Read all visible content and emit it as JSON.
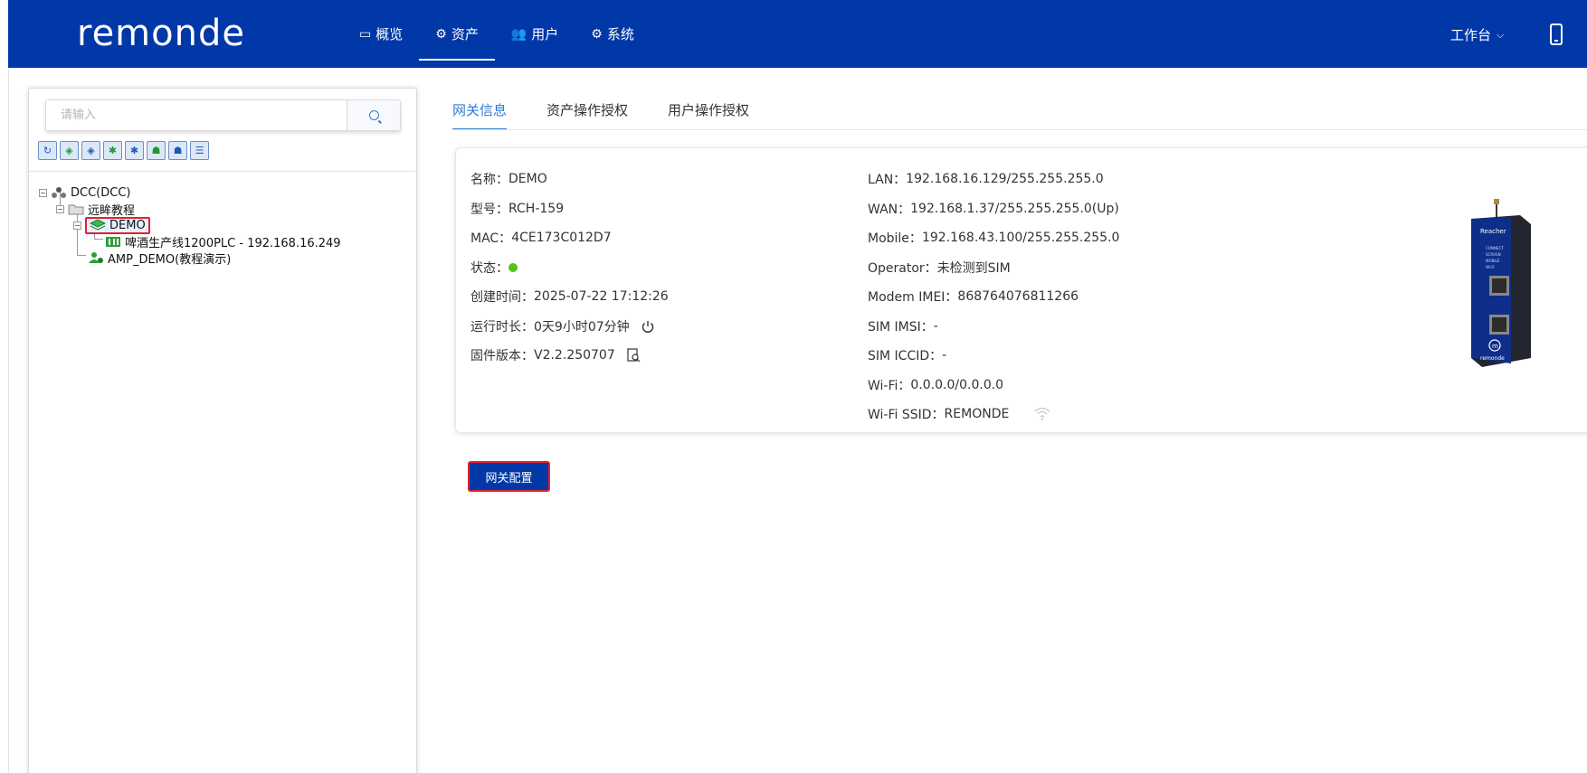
{
  "header": {
    "logo_text": "remonde",
    "nav": [
      {
        "label": "概览",
        "icon": "monitor-icon"
      },
      {
        "label": "资产",
        "icon": "gears-icon"
      },
      {
        "label": "用户",
        "icon": "users-icon"
      },
      {
        "label": "系统",
        "icon": "gear-icon"
      }
    ],
    "active_nav": "资产",
    "workbench_label": "工作台",
    "brand_color": "#0038a8"
  },
  "sidebar": {
    "search": {
      "placeholder": "请输入",
      "value": ""
    },
    "toolbar": [
      "refresh-icon",
      "gateway-add-icon",
      "gateway-icon",
      "device-add-icon",
      "device-settings-icon",
      "user-group-add-icon",
      "user-group-icon",
      "list-icon"
    ],
    "tree": {
      "root": "DCC(DCC)",
      "folder": "远眸教程",
      "selected_gateway": "DEMO",
      "device": "啤酒生产线1200PLC - 192.168.16.249",
      "user_node": "AMP_DEMO(教程演示)"
    }
  },
  "tabs": [
    {
      "label": "网关信息"
    },
    {
      "label": "资产操作授权"
    },
    {
      "label": "用户操作授权"
    }
  ],
  "gateway_info": {
    "left": [
      {
        "label": "名称：",
        "value": "DEMO"
      },
      {
        "label": "型号：",
        "value": "RCH-159"
      },
      {
        "label": "MAC：",
        "value": "4CE173C012D7"
      },
      {
        "label": "状态：",
        "value": ""
      },
      {
        "label": "创建时间：",
        "value": "2025-07-22 17:12:26"
      },
      {
        "label": "运行时长：",
        "value": "0天9小时07分钟"
      },
      {
        "label": "固件版本：",
        "value": "V2.2.250707"
      }
    ],
    "right": [
      {
        "label": "LAN：",
        "value": "192.168.16.129/255.255.255.0"
      },
      {
        "label": "WAN：",
        "value": "192.168.1.37/255.255.255.0(Up)"
      },
      {
        "label": "Mobile：",
        "value": "192.168.43.100/255.255.255.0"
      },
      {
        "label": "Operator：",
        "value": "未检测到SIM"
      },
      {
        "label": "Modem IMEI：",
        "value": "868764076811266"
      },
      {
        "label": "SIM IMSI：",
        "value": "-"
      },
      {
        "label": "SIM ICCID：",
        "value": "-"
      },
      {
        "label": "Wi-Fi：",
        "value": "0.0.0.0/0.0.0.0"
      },
      {
        "label": "Wi-Fi SSID：",
        "value": "REMONDE"
      }
    ],
    "status_color": "#52c41a",
    "device_image_label": "Reacher",
    "device_image_brand": "remonde",
    "device_port_labels": [
      "CONNECT",
      "SCRUSN",
      "MOBILE",
      "Wi-Fi"
    ]
  },
  "actions": {
    "config_button_label": "网关配置"
  }
}
